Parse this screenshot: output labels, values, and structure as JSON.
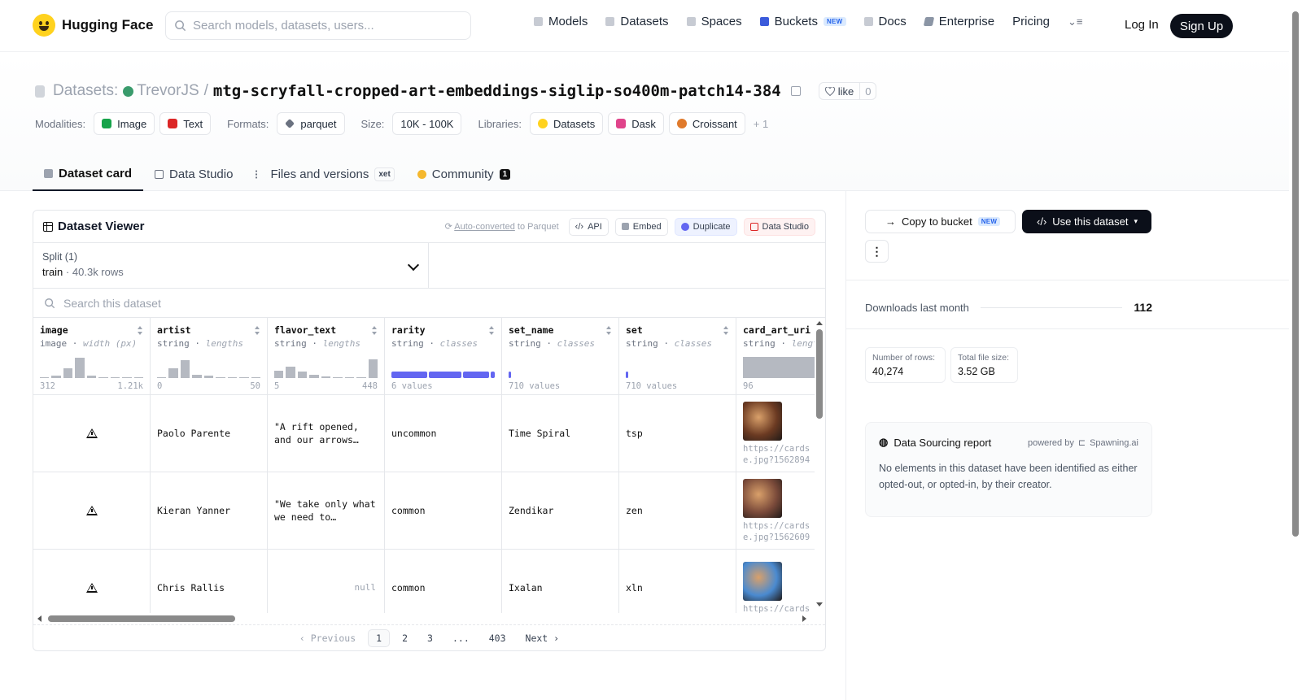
{
  "header": {
    "brand": "Hugging Face",
    "search_placeholder": "Search models, datasets, users...",
    "nav": [
      {
        "label": "Models",
        "icon": "models-icon"
      },
      {
        "label": "Datasets",
        "icon": "datasets-icon"
      },
      {
        "label": "Spaces",
        "icon": "spaces-icon"
      },
      {
        "label": "Buckets",
        "icon": "buckets-icon",
        "badge": "NEW"
      },
      {
        "label": "Docs",
        "icon": "docs-icon"
      },
      {
        "label": "Enterprise",
        "icon": "enterprise-icon"
      },
      {
        "label": "Pricing"
      }
    ],
    "login": "Log In",
    "signup": "Sign Up"
  },
  "repo": {
    "section": "Datasets:",
    "owner": "TrevorJS",
    "separator": "/",
    "name": "mtg-scryfall-cropped-art-embeddings-siglip-so400m-patch14-384",
    "like_label": "like",
    "like_count": "0",
    "modalities_label": "Modalities:",
    "modalities": [
      "Image",
      "Text"
    ],
    "formats_label": "Formats:",
    "formats": [
      "parquet"
    ],
    "size_label": "Size:",
    "size": "10K - 100K",
    "libraries_label": "Libraries:",
    "libraries": [
      "Datasets",
      "Dask",
      "Croissant"
    ],
    "libraries_more": "+ 1"
  },
  "tabs": [
    {
      "label": "Dataset card",
      "active": true
    },
    {
      "label": "Data Studio"
    },
    {
      "label": "Files and versions",
      "badge": "xet"
    },
    {
      "label": "Community",
      "count": "1"
    }
  ],
  "viewer": {
    "title": "Dataset Viewer",
    "auto_converted_link": "Auto-converted",
    "auto_converted_rest": "to Parquet",
    "actions": [
      "API",
      "Embed",
      "Duplicate",
      "Data Studio"
    ],
    "split_label": "Split (1)",
    "split_name": "train",
    "split_dot": "·",
    "split_rows": "40.3k rows",
    "search_placeholder": "Search this dataset",
    "columns": [
      {
        "name": "image",
        "type": "image",
        "stat": "width (px)",
        "min": "312",
        "max": "1.21k",
        "hist": [
          0.05,
          0.1,
          0.45,
          0.95,
          0.1,
          0.05,
          0.05,
          0.05,
          0.05
        ]
      },
      {
        "name": "artist",
        "type": "string",
        "stat": "lengths",
        "min": "0",
        "max": "50",
        "hist": [
          0.05,
          0.45,
          0.85,
          0.15,
          0.1,
          0.05,
          0.05,
          0.05,
          0.05
        ]
      },
      {
        "name": "flavor_text",
        "type": "string",
        "stat": "lengths",
        "min": "5",
        "max": "448",
        "hist": [
          0.35,
          0.55,
          0.3,
          0.15,
          0.08,
          0.05,
          0.05,
          0.05,
          0.9
        ]
      },
      {
        "name": "rarity",
        "type": "string",
        "stat": "classes",
        "summary": "6 values",
        "classes": [
          0.36,
          0.33,
          0.27,
          0.04
        ]
      },
      {
        "name": "set_name",
        "type": "string",
        "stat": "classes",
        "summary": "710 values",
        "classes": [
          0.02
        ]
      },
      {
        "name": "set",
        "type": "string",
        "stat": "classes",
        "summary": "710 values",
        "classes": [
          0.02
        ]
      },
      {
        "name": "card_art_uri",
        "type": "string",
        "stat": "lengths",
        "min": "96",
        "hist": [
          1.0
        ]
      }
    ],
    "rows": [
      {
        "artist": "Paolo Parente",
        "flavor_text": "\"A rift opened, and our arrows…",
        "rarity": "uncommon",
        "set_name": "Time Spiral",
        "set": "tsp",
        "card_art_uri": "https://cards",
        "card_art_uri_2": "e.jpg?1562894",
        "art_color": "#6b3a22"
      },
      {
        "artist": "Kieran Yanner",
        "flavor_text": "\"We take only what we need to…",
        "rarity": "common",
        "set_name": "Zendikar",
        "set": "zen",
        "card_art_uri": "https://cards",
        "card_art_uri_2": "e.jpg?1562609",
        "art_color": "#7a4a3a"
      },
      {
        "artist": "Chris Rallis",
        "flavor_text": "null",
        "rarity": "common",
        "set_name": "Ixalan",
        "set": "xln",
        "card_art_uri": "https://cards",
        "card_art_uri_2": "",
        "art_color": "#4a8ad0"
      }
    ],
    "pager": {
      "prev": "‹ Previous",
      "pages": [
        "1",
        "2",
        "3",
        "...",
        "403"
      ],
      "current": "1",
      "next": "Next ›"
    }
  },
  "sidebar": {
    "copy_bucket": "Copy to bucket",
    "copy_bucket_badge": "NEW",
    "use_dataset": "Use this dataset",
    "more": "⋮",
    "downloads_label": "Downloads last month",
    "downloads": "112",
    "rows_label": "Number of rows:",
    "rows": "40,274",
    "size_label": "Total file size:",
    "size": "3.52 GB",
    "report_title": "Data Sourcing report",
    "powered_by": "powered by",
    "powered_name": "Spawning.ai",
    "report_text": "No elements in this dataset have been identified as either opted-out, or opted-in, by their creator."
  },
  "colors": {
    "accent_dark": "#0b0f19",
    "class_bar": "#6366f1",
    "hist_bar": "#b5b9c1"
  }
}
